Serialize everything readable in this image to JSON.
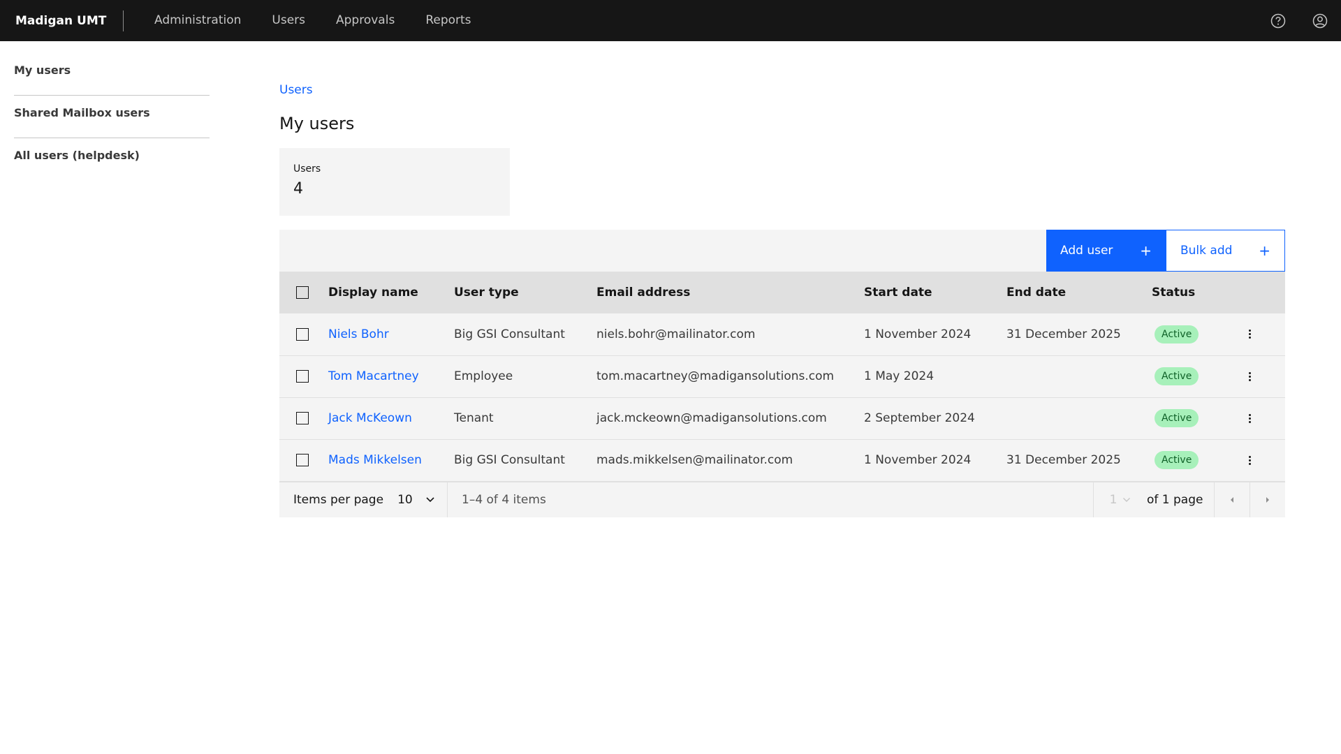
{
  "header": {
    "brand": "Madigan UMT",
    "nav": [
      "Administration",
      "Users",
      "Approvals",
      "Reports"
    ]
  },
  "sidenav": {
    "items": [
      "My users",
      "Shared Mailbox users",
      "All users (helpdesk)"
    ]
  },
  "main": {
    "breadcrumb": "Users",
    "title": "My users",
    "tile": {
      "label": "Users",
      "value": "4"
    },
    "toolbar": {
      "add_user": "Add user",
      "bulk_add": "Bulk add",
      "plus": "+"
    },
    "table": {
      "headers": [
        "Display name",
        "User type",
        "Email address",
        "Start date",
        "End date",
        "Status"
      ],
      "rows": [
        {
          "name": "Niels Bohr",
          "type": "Big GSI Consultant",
          "email": "niels.bohr@mailinator.com",
          "start": "1 November 2024",
          "end": "31 December 2025",
          "status": "Active"
        },
        {
          "name": "Tom Macartney",
          "type": "Employee",
          "email": "tom.macartney@madigansolutions.com",
          "start": "1 May 2024",
          "end": "",
          "status": "Active"
        },
        {
          "name": "Jack McKeown",
          "type": "Tenant",
          "email": "jack.mckeown@madigansolutions.com",
          "start": "2 September 2024",
          "end": "",
          "status": "Active"
        },
        {
          "name": "Mads Mikkelsen",
          "type": "Big GSI Consultant",
          "email": "mads.mikkelsen@mailinator.com",
          "start": "1 November 2024",
          "end": "31 December 2025",
          "status": "Active"
        }
      ]
    },
    "pagination": {
      "items_per_page_label": "Items per page",
      "items_per_page": "10",
      "range": "1–4 of 4 items",
      "page": "1",
      "of_pages": "of 1 page"
    }
  },
  "colors": {
    "primary": "#0f62fe",
    "header_bg": "#161616",
    "active_tag_bg": "#a7f0ba",
    "active_tag_text": "#0e6027"
  }
}
